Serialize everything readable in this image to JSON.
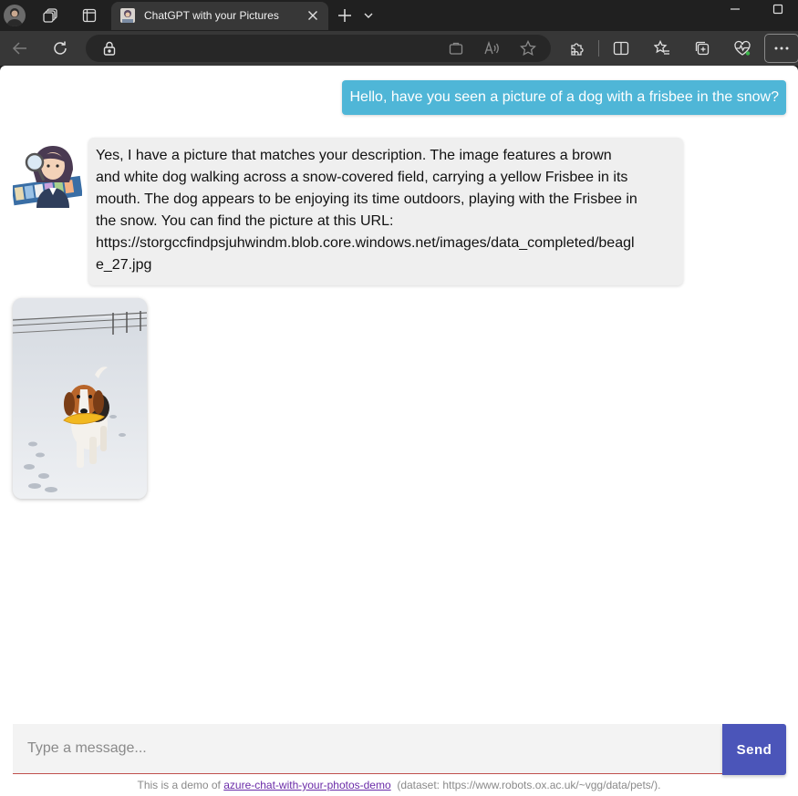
{
  "browser": {
    "tab_title": "ChatGPT with your Pictures",
    "icons": {
      "profile": "profile-avatar",
      "workspaces": "workspaces-icon",
      "tab_actions": "vertical-tabs-icon",
      "new_tab": "plus-icon",
      "tab_list": "chevron-down-icon",
      "back": "back-arrow-icon",
      "refresh": "refresh-icon",
      "site_info": "lock-icon",
      "app_available": "app-icon",
      "read_aloud": "read-aloud-icon",
      "favorite": "star-icon",
      "extensions": "puzzle-icon",
      "split_screen": "split-screen-icon",
      "favorites": "favorites-icon",
      "collections": "collections-icon",
      "browser_essentials": "heart-pulse-icon",
      "more": "ellipsis-icon"
    }
  },
  "chat": {
    "user_message": "Hello, have you seen a picture of a dog with a frisbee in the snow?",
    "bot_message_lines": [
      "Yes, I have a picture that matches your description. The image features a brown",
      "and white dog walking across a snow-covered field, carrying a yellow Frisbee in its",
      "mouth. The dog appears to be enjoying its time outdoors, playing with the Frisbee in",
      "the snow. You can find the picture at this URL:",
      "https://storgccfindpsjuhwindm.blob.core.windows.net/images/data_completed/beagl",
      "e_27.jpg"
    ]
  },
  "composer": {
    "placeholder": "Type a message...",
    "send_label": "Send"
  },
  "footer": {
    "prefix": "This is a demo of ",
    "link_text": "azure-chat-with-your-photos-demo",
    "suffix": "  (dataset: https://www.robots.ox.ac.uk/~vgg/data/pets/)."
  },
  "colors": {
    "user_bubble": "#4fb6d7",
    "bot_bubble": "#efefef",
    "send_button": "#4b55b9",
    "input_underline": "#c0504d",
    "link": "#6a2ba8"
  }
}
